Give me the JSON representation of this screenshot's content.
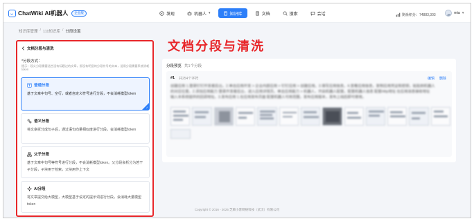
{
  "header": {
    "brand_name": "ChatWiki AI机器人",
    "brand_badge": "企业版",
    "nav": [
      {
        "label": "发现",
        "icon": "compass-icon",
        "active": false,
        "caret": false
      },
      {
        "label": "机器人",
        "icon": "robot-icon",
        "active": false,
        "caret": true
      },
      {
        "label": "知识库",
        "icon": "book-icon",
        "active": true,
        "caret": false
      },
      {
        "label": "文档",
        "icon": "document-icon",
        "active": false,
        "caret": false
      },
      {
        "label": "搜索",
        "icon": "search-icon",
        "active": false,
        "caret": false
      },
      {
        "label": "会话",
        "icon": "chat-icon",
        "active": false,
        "caret": false
      }
    ],
    "points": "剩余积分：74883,303",
    "username": "mia",
    "accent": "#2d7ff9"
  },
  "breadcrumb": {
    "items": [
      "知识库管理",
      "111知识库",
      "分段设置"
    ],
    "separator": "/"
  },
  "left_panel": {
    "title": "文档分段与清洗",
    "caption": "*分段方式：",
    "hint": "提示：段义分段需要适合没有标题过的文章，即没有明显的分段符号的文本，适用分段需要系统消耗token",
    "options": [
      {
        "icon": "text-icon",
        "title": "普通分段",
        "desc": "基于文章中句号、空行，或者自定义符号进行分段，不会消耗模型token",
        "selected": true
      },
      {
        "icon": "semantic-icon",
        "title": "语义分段",
        "desc": "将文章拆分成句子后，通过语句向量相似度进行分段，会消耗模型token",
        "selected": false
      },
      {
        "icon": "parent-child-icon",
        "title": "父子分段",
        "desc": "基于文章中句号等符号进行分段，不会消耗模型token。父分段会析分为若干子分段，子块用于检索，父块用作上下文",
        "selected": false
      },
      {
        "icon": "ai-icon",
        "title": "AI分段",
        "desc": "将文章提交给大模型，大模型基于设定的提示词进行分段，会消耗大量模型token",
        "selected": false
      }
    ]
  },
  "annotation": "文档分段与清洗",
  "preview": {
    "title": "分段预览",
    "count_label": "共1个分段",
    "segment_id": "#1",
    "segment_chars": "共254个字符",
    "edit_label": "编辑",
    "delete_label": "删除",
    "content_lines": [
      "创建应用 1.登录钉钉开发者后台。2.单击应用开发 > 企业内部应用 > 钉钉应用 > 创建应用。3.填写应用信息。4.查看应用信息，复制应用凭证和密钥，粘贴到机器人",
      "的对应位置。2.添加应用能力 登录开发者后台，进入应用详情页。单击应用能力 > 机器人，开启机器人配置。配置机器人信息 配置Http地址 在应用消息接收地址",
      "输入本系统提供的回调地址。3.发布应用 1.在应用发布页面 配置机器人可用范围，发布应用版本，发布上线后即可使用。"
    ]
  },
  "footer": "Copyright © 2016 - 2025 芝麻小客网络科技（武汉）有限公司"
}
